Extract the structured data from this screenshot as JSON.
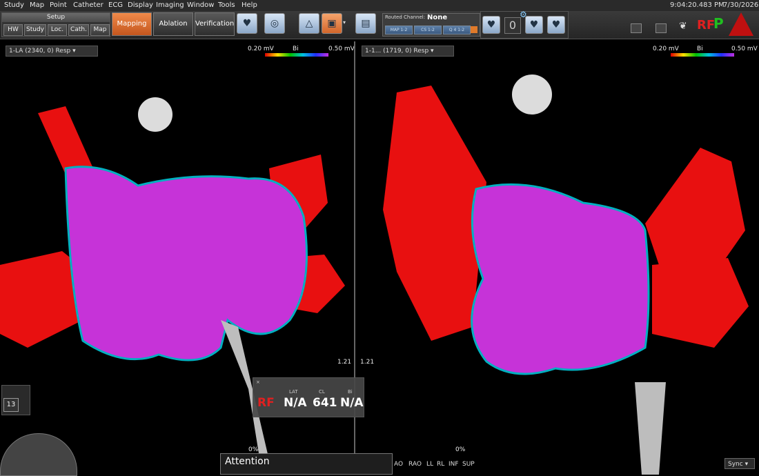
{
  "menu": [
    "Study",
    "Map",
    "Point",
    "Catheter",
    "ECG",
    "Display",
    "Imaging",
    "Window",
    "Tools",
    "Help"
  ],
  "clock": {
    "time": "9:04:20.483 PM",
    "date": "7/30/2026"
  },
  "setup": {
    "title": "Setup",
    "buttons": [
      "HW",
      "Study",
      "Loc.",
      "Cath.",
      "Map"
    ]
  },
  "modes": {
    "mapping": "Mapping",
    "ablation": "Ablation",
    "verification": "Verification"
  },
  "routed": {
    "label": "Routed Channel:",
    "value": "None",
    "channels": [
      "MAP 1-2",
      "CS 1-2",
      "Q 4 1-2"
    ]
  },
  "counter": "0",
  "left_panel": {
    "title": "1-LA (2340, 0) Resp",
    "scale_min": "0.20 mV",
    "scale_mode": "Bi",
    "scale_max": "0.50 mV"
  },
  "right_panel": {
    "title": "1-1... (1719, 0) Resp",
    "scale_min": "0.20 mV",
    "scale_mode": "Bi",
    "scale_max": "0.50 mV"
  },
  "side_counter": "13",
  "rf_label": "RF",
  "overlay": {
    "headers": [
      "LAT",
      "CL",
      "Bi"
    ],
    "rf": "RF",
    "lat": "N/A",
    "cl": "641",
    "bi": "N/A"
  },
  "slider_values": [
    "1.21",
    "1.21"
  ],
  "zoom": [
    "0%",
    "0%"
  ],
  "attention": "Attention",
  "views": [
    "AO",
    "RAO",
    "LL",
    "RL",
    "INF",
    "SUP"
  ],
  "sync": "Sync",
  "colors": {
    "mapping_active": "#e06a2c",
    "scar": "#ee1111",
    "healthy": "#cc33dd",
    "background": "#000000"
  }
}
